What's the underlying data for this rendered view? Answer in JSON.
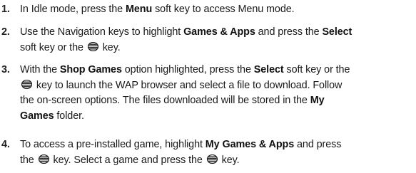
{
  "steps": [
    {
      "number": "1.",
      "lines": [
        [
          {
            "t": "In Idle mode, press the "
          },
          {
            "t": "Menu",
            "b": true
          },
          {
            "t": " soft key to access Menu mode."
          }
        ]
      ]
    },
    {
      "number": "2.",
      "lines": [
        [
          {
            "t": "Use the Navigation keys to highlight "
          },
          {
            "t": "Games & Apps",
            "b": true
          },
          {
            "t": " and press the "
          },
          {
            "t": "Select",
            "b": true
          }
        ],
        [
          {
            "t": "soft key or the "
          },
          {
            "icon": "select-key-icon"
          },
          {
            "t": " key."
          }
        ]
      ]
    },
    {
      "number": "3.",
      "lines": [
        [
          {
            "t": "With the "
          },
          {
            "t": "Shop Games",
            "b": true
          },
          {
            "t": " option highlighted, press the "
          },
          {
            "t": "Select",
            "b": true
          },
          {
            "t": " soft key or the"
          }
        ],
        [
          {
            "icon": "select-key-icon"
          },
          {
            "t": " key to launch the WAP browser and select a file to download. Follow"
          }
        ],
        [
          {
            "t": "the on-screen options. The files downloaded will be stored in the "
          },
          {
            "t": "My",
            "b": true
          }
        ],
        [
          {
            "t": "Games",
            "b": true
          },
          {
            "t": " folder."
          }
        ]
      ]
    },
    {
      "number": "4.",
      "lines": [
        [
          {
            "t": "To access a pre-installed game, highlight "
          },
          {
            "t": "My Games & Apps",
            "b": true
          },
          {
            "t": " and press"
          }
        ],
        [
          {
            "t": "the "
          },
          {
            "icon": "select-key-icon"
          },
          {
            "t": " key. Select a game and press the "
          },
          {
            "icon": "select-key-icon"
          },
          {
            "t": " key."
          }
        ]
      ]
    }
  ]
}
